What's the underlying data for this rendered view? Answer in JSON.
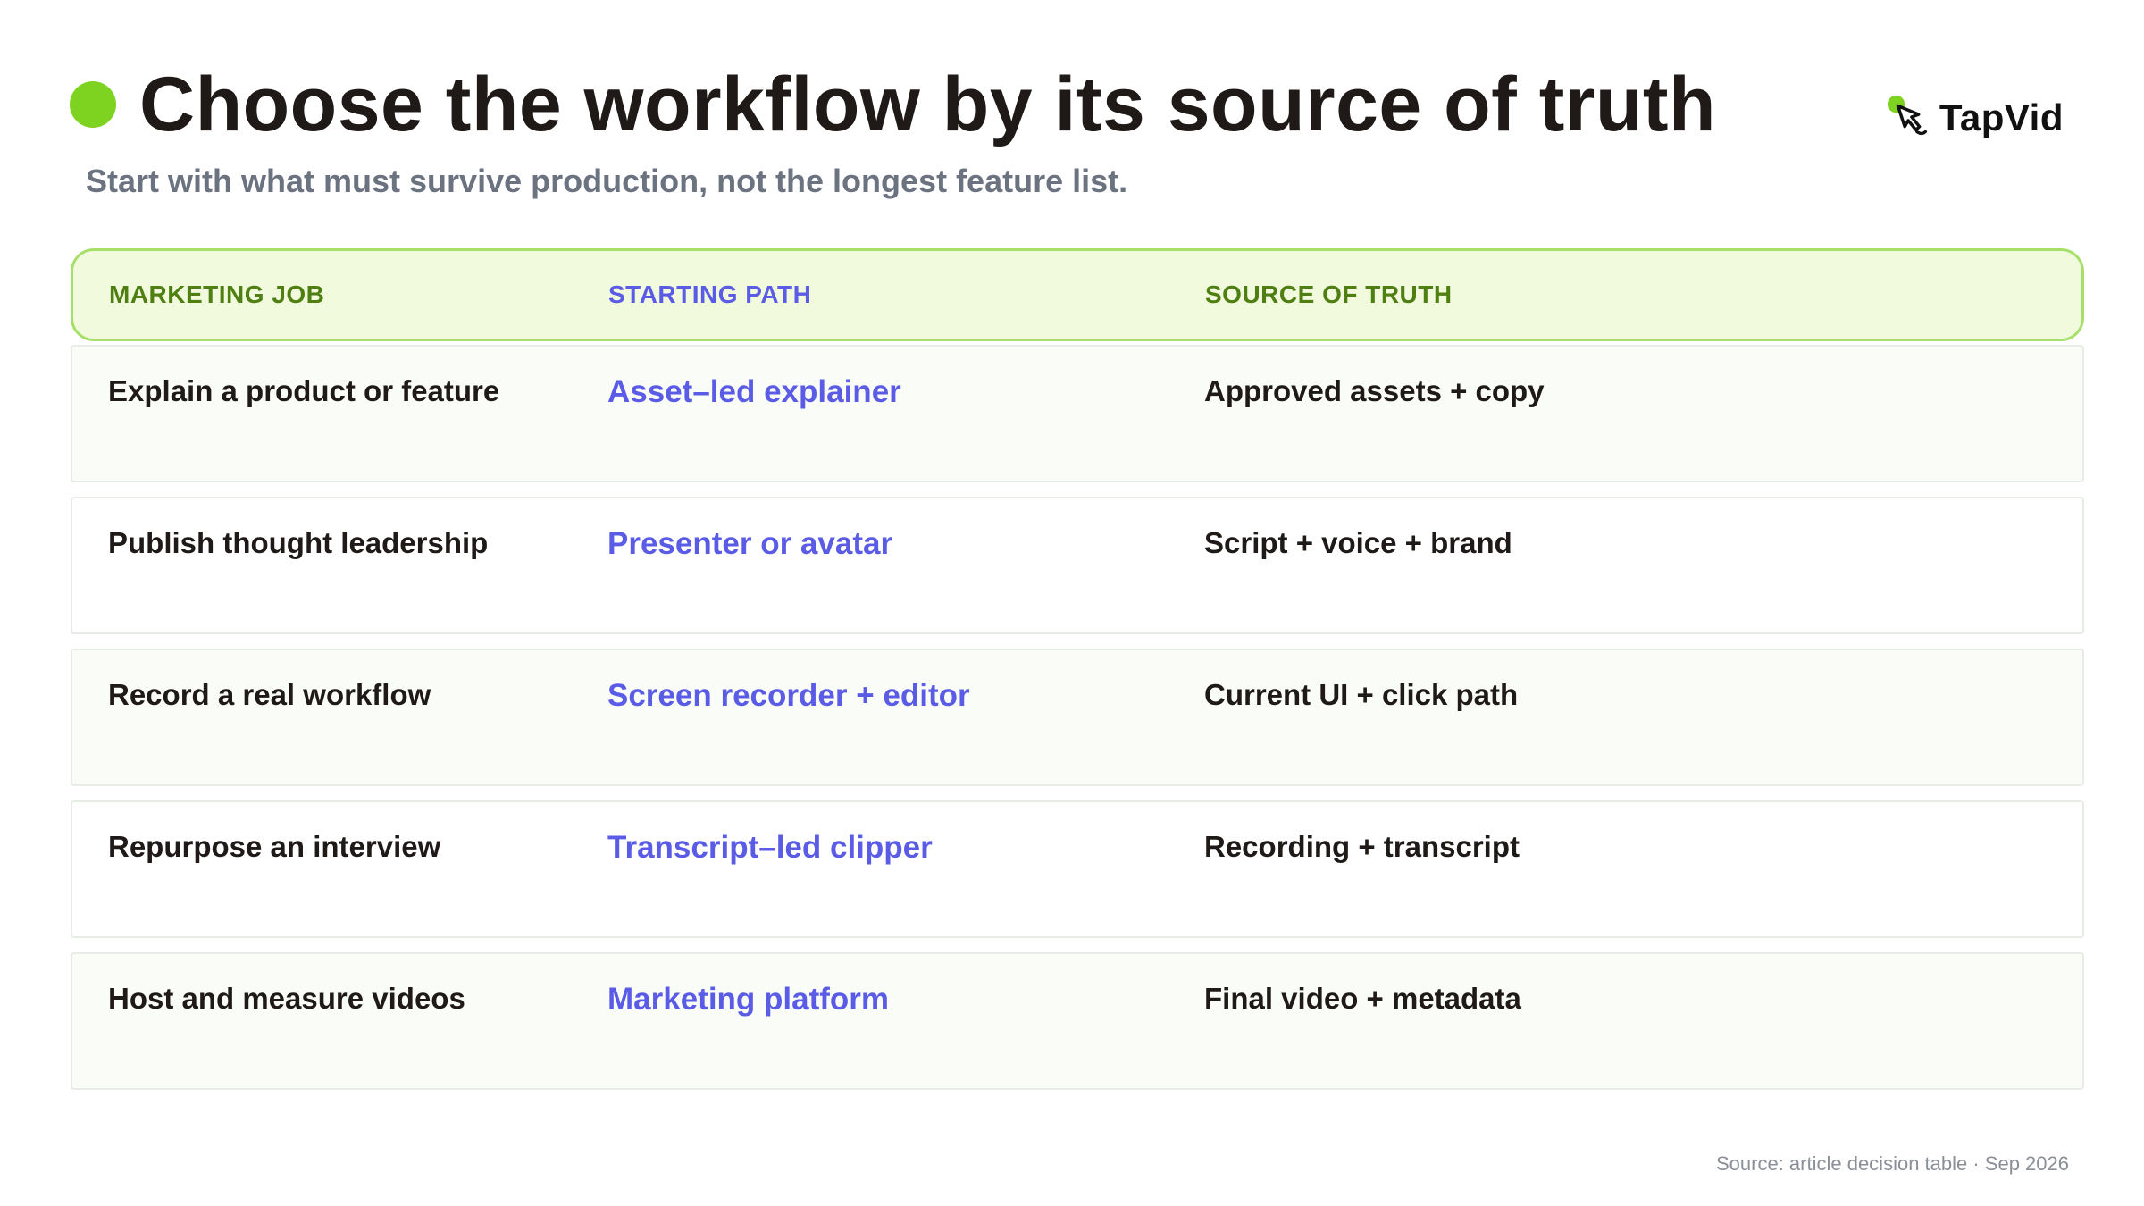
{
  "header": {
    "title": "Choose the workflow by its source of truth",
    "subtitle": "Start with what must survive production, not the longest feature list.",
    "accent_color": "#7ed321"
  },
  "logo": {
    "text": "TapVid",
    "icon": "hand-pointer-icon"
  },
  "table": {
    "columns": [
      {
        "label": "MARKETING JOB",
        "color": "#4f7f12"
      },
      {
        "label": "STARTING PATH",
        "color": "#5b5ce6"
      },
      {
        "label": "SOURCE OF TRUTH",
        "color": "#4f7f12"
      }
    ],
    "rows": [
      {
        "job": "Explain a product or feature",
        "path": "Asset–led explainer",
        "truth": "Approved assets + copy"
      },
      {
        "job": "Publish thought leadership",
        "path": "Presenter or avatar",
        "truth": "Script + voice + brand"
      },
      {
        "job": "Record a real workflow",
        "path": "Screen recorder + editor",
        "truth": "Current UI + click path"
      },
      {
        "job": "Repurpose an interview",
        "path": "Transcript–led clipper",
        "truth": "Recording + transcript"
      },
      {
        "job": "Host and measure videos",
        "path": "Marketing platform",
        "truth": "Final video + metadata"
      }
    ],
    "path_color": "#5b5ce6",
    "header_bg": "#f2fadd",
    "header_border": "#a6e06a"
  },
  "footer": {
    "source": "Source: article decision table · Sep 2026"
  }
}
